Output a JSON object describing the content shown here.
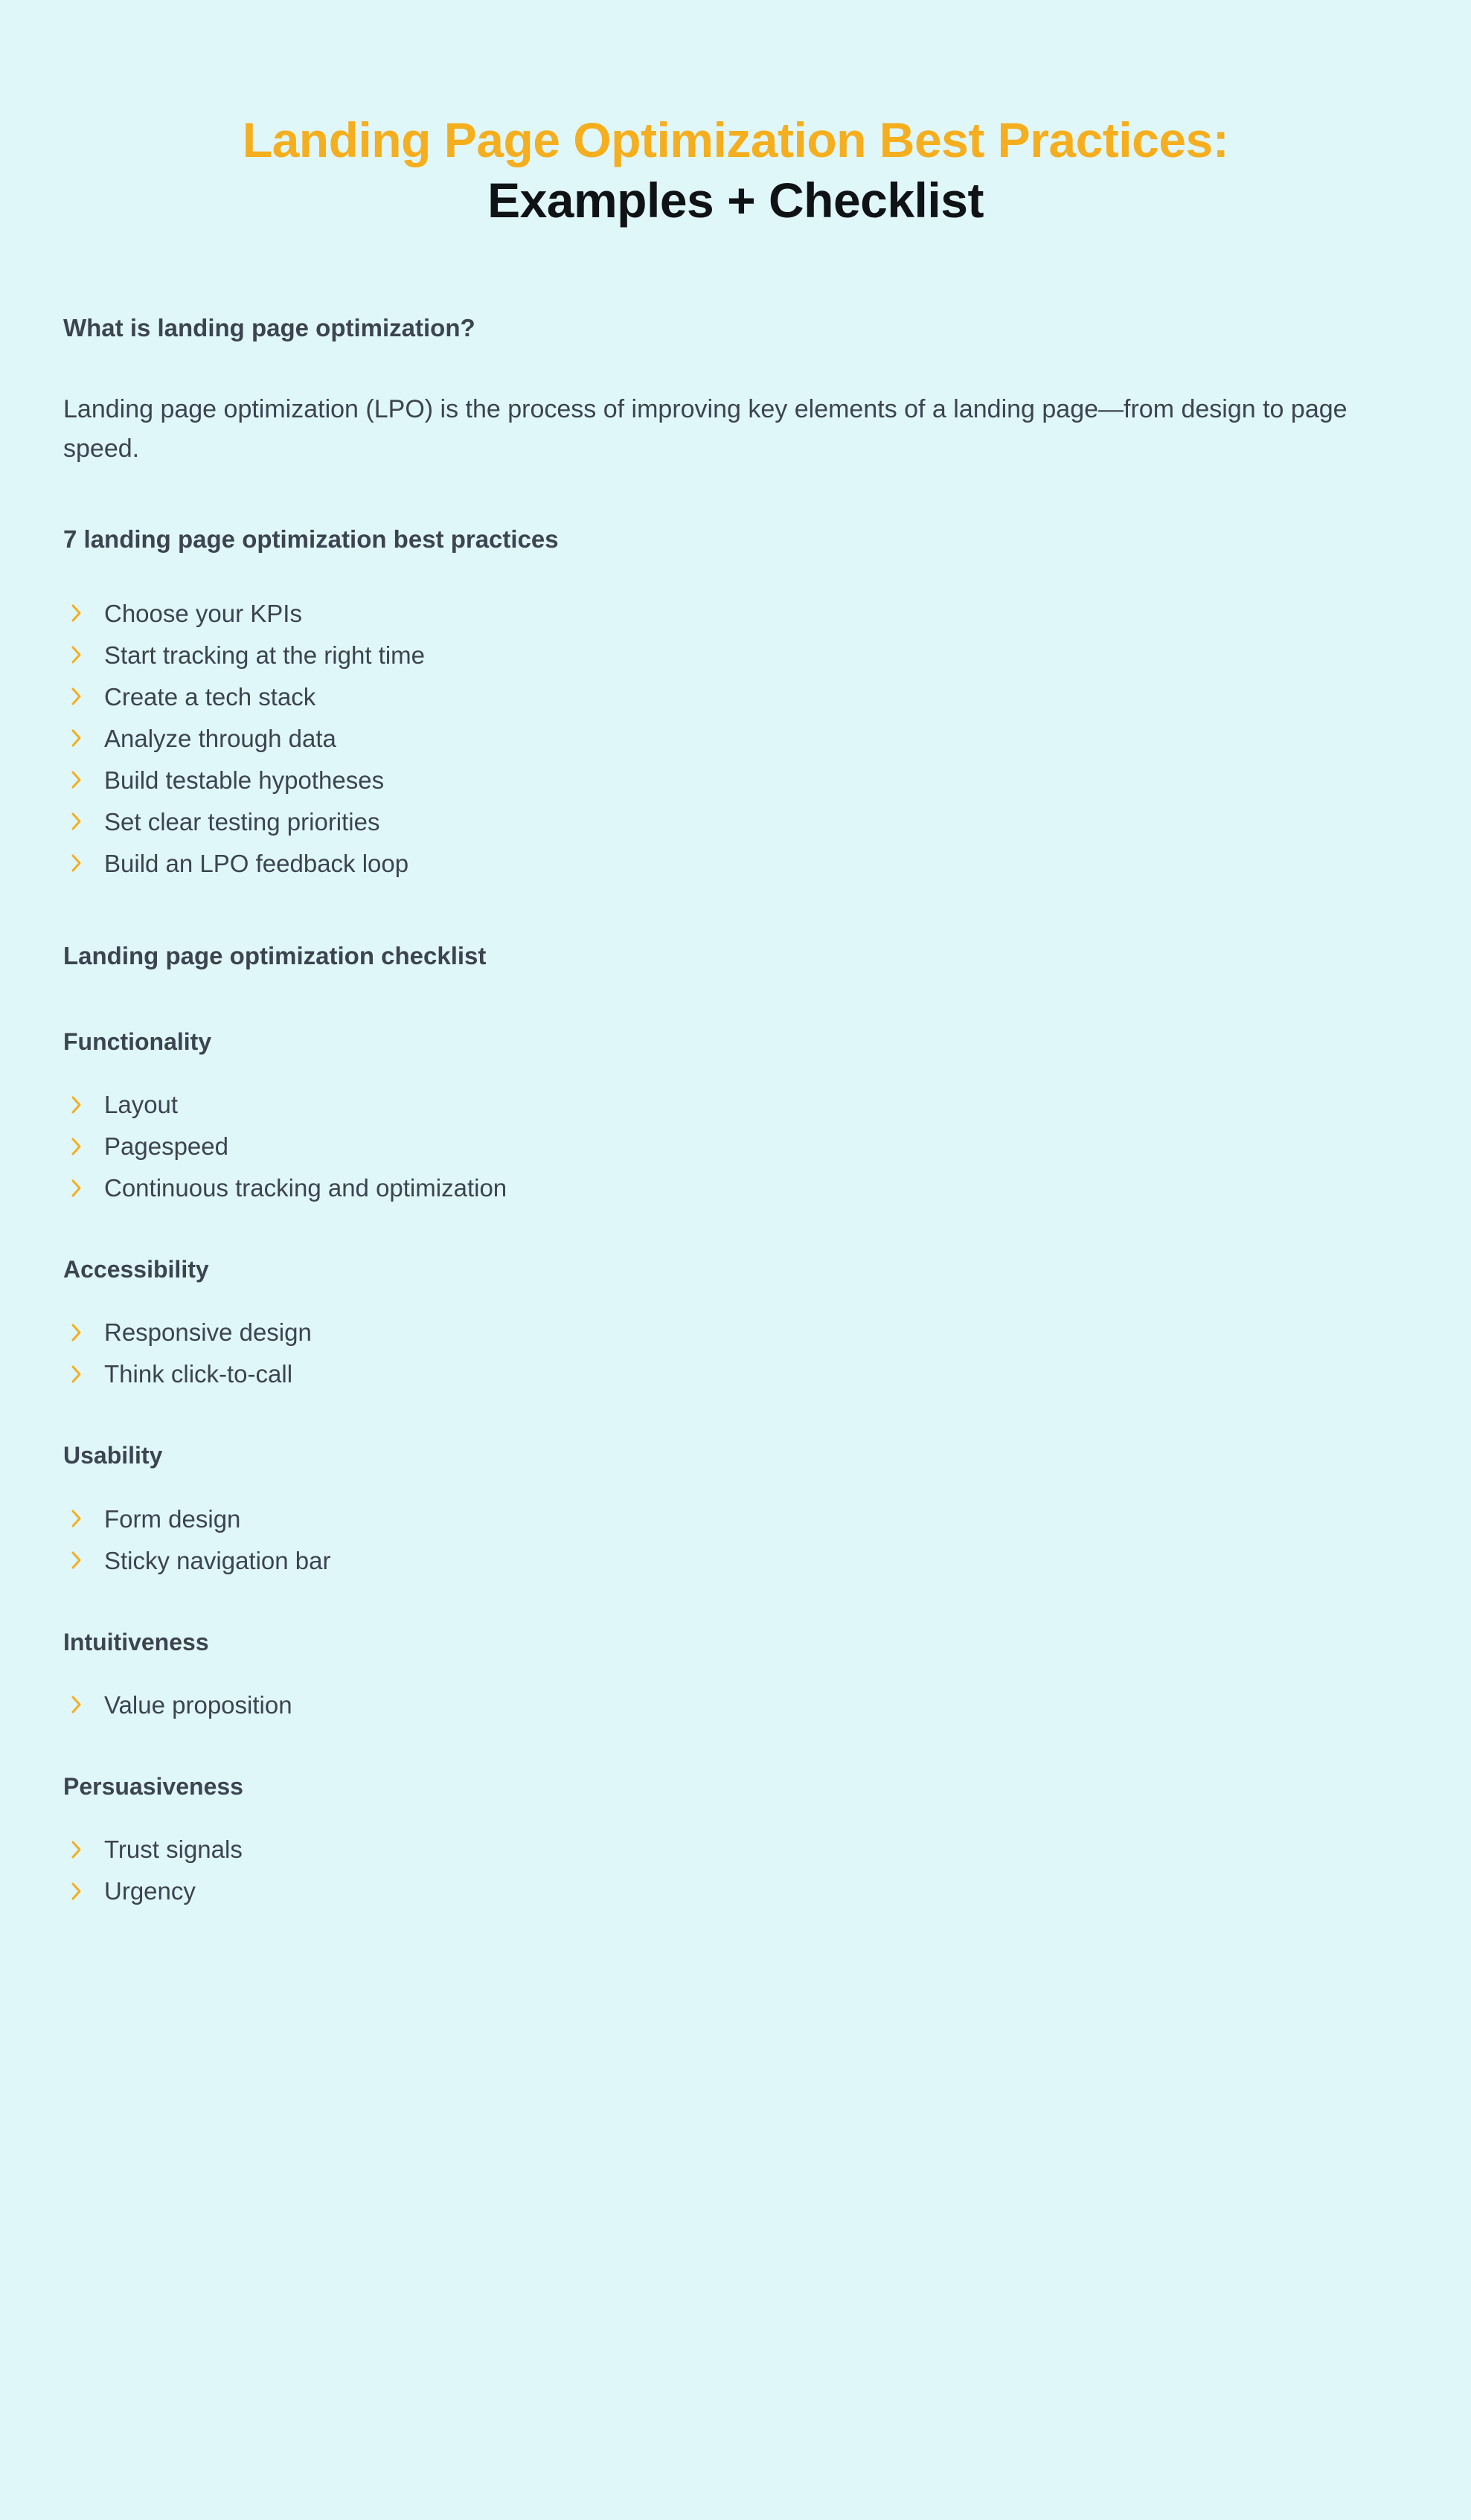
{
  "colors": {
    "background": "#e0f7f9",
    "title_accent": "#f5ae1e",
    "title_dark": "#101316",
    "body_text": "#3c4450",
    "bullet_chevron": "#f5ae1e"
  },
  "title": {
    "line1": "Landing Page Optimization Best Practices:",
    "line2": "Examples + Checklist"
  },
  "sections": {
    "what_is": {
      "heading": "What is landing page optimization?",
      "paragraph": "Landing page optimization (LPO) is the process of improving key elements of a landing page—from design to page speed."
    },
    "best_practices": {
      "heading": "7 landing page optimization best practices",
      "items": [
        "Choose your KPIs",
        "Start tracking at the right time",
        "Create a tech stack",
        "Analyze through data",
        "Build testable hypotheses",
        "Set clear testing priorities",
        "Build an LPO feedback loop"
      ]
    },
    "checklist": {
      "heading": "Landing page optimization checklist",
      "groups": [
        {
          "label": "Functionality",
          "items": [
            "Layout",
            "Pagespeed",
            "Continuous tracking and optimization"
          ]
        },
        {
          "label": "Accessibility",
          "items": [
            "Responsive design",
            "Think click-to-call"
          ]
        },
        {
          "label": "Usability",
          "items": [
            "Form design",
            "Sticky navigation bar"
          ]
        },
        {
          "label": "Intuitiveness",
          "items": [
            "Value proposition"
          ]
        },
        {
          "label": "Persuasiveness",
          "items": [
            "Trust signals",
            "Urgency"
          ]
        }
      ]
    }
  },
  "icons": {
    "bullet": "chevron-right-icon"
  }
}
